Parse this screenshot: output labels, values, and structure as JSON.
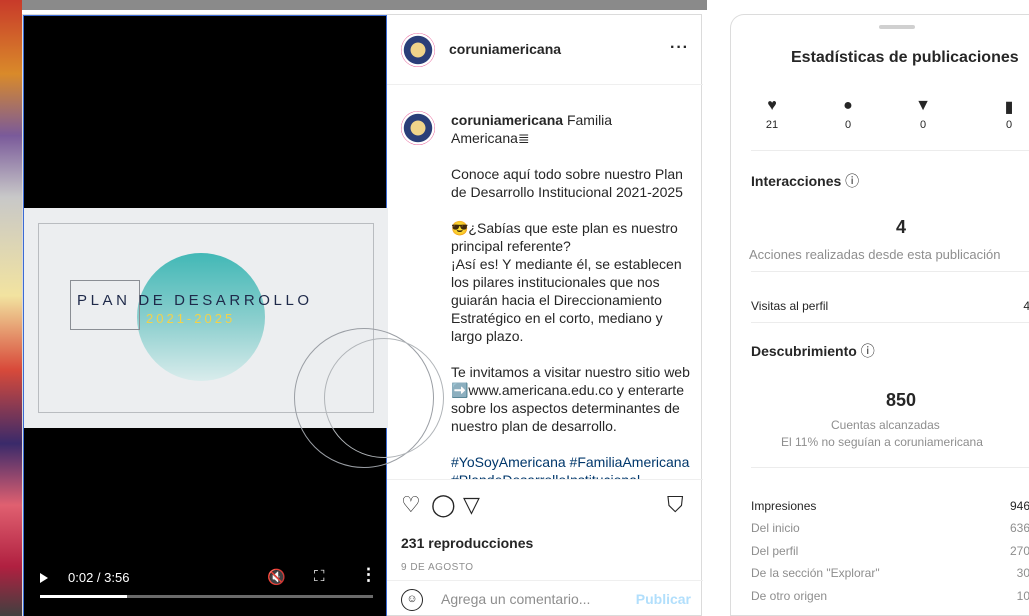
{
  "post": {
    "username": "coruniamericana",
    "more_label": "···",
    "caption_user": "coruniamericana",
    "caption_lines": [
      "Familia Americana≣",
      "Conoce aquí todo sobre nuestro Plan de Desarrollo Institucional 2021-2025",
      "😎¿Sabías que este plan es nuestro principal referente?",
      "¡Así es! Y mediante él, se establecen los pilares institucionales que nos guiarán hacia el Direccionamiento Estratégico en el corto, mediano y largo plazo.",
      "Te invitamos a visitar nuestro sitio web ➡️www.americana.edu.co y enterarte sobre los aspectos determinantes de nuestro plan de desarrollo.",
      "#YoSoyAmericana #FamiliaAmericana #PlandeDesarrolloInstitucional"
    ],
    "views": "231 reproducciones",
    "date": "9 DE AGOSTO",
    "comment_placeholder": "Agrega un comentario...",
    "publish_label": "Publicar"
  },
  "video": {
    "slide_title": "PLAN DE DESARROLLO",
    "slide_years": "2021-2025",
    "time": "0:02 / 3:56",
    "progress_fraction": 0.26
  },
  "stats": {
    "title": "Estadísticas de publicaciones",
    "metrics": [
      {
        "icon": "heart-icon",
        "glyph": "♥",
        "value": "21"
      },
      {
        "icon": "comment-icon",
        "glyph": "●",
        "value": "0"
      },
      {
        "icon": "share-icon",
        "glyph": "▼",
        "value": "0"
      },
      {
        "icon": "save-icon",
        "glyph": "▮",
        "value": "0"
      }
    ],
    "interactions_label": "Interacciones",
    "interactions_value": "4",
    "interactions_caption": "Acciones realizadas desde esta publicación",
    "profile_visits_label": "Visitas al perfil",
    "profile_visits_value": "4",
    "discovery_label": "Descubrimiento",
    "reach_value": "850",
    "reach_caption": "Cuentas alcanzadas",
    "reach_note": "El 11% no seguían a coruniamericana",
    "impressions_label": "Impresiones",
    "impressions_value": "946",
    "rows": [
      {
        "label": "Del inicio",
        "value": "636"
      },
      {
        "label": "Del perfil",
        "value": "270"
      },
      {
        "label": "De la sección \"Explorar\"",
        "value": "30"
      },
      {
        "label": "De otro origen",
        "value": "10"
      }
    ]
  },
  "colors": {
    "accent": "#0095f6",
    "publish_disabled": "#b2dffc",
    "teal": "#42b8b6"
  }
}
